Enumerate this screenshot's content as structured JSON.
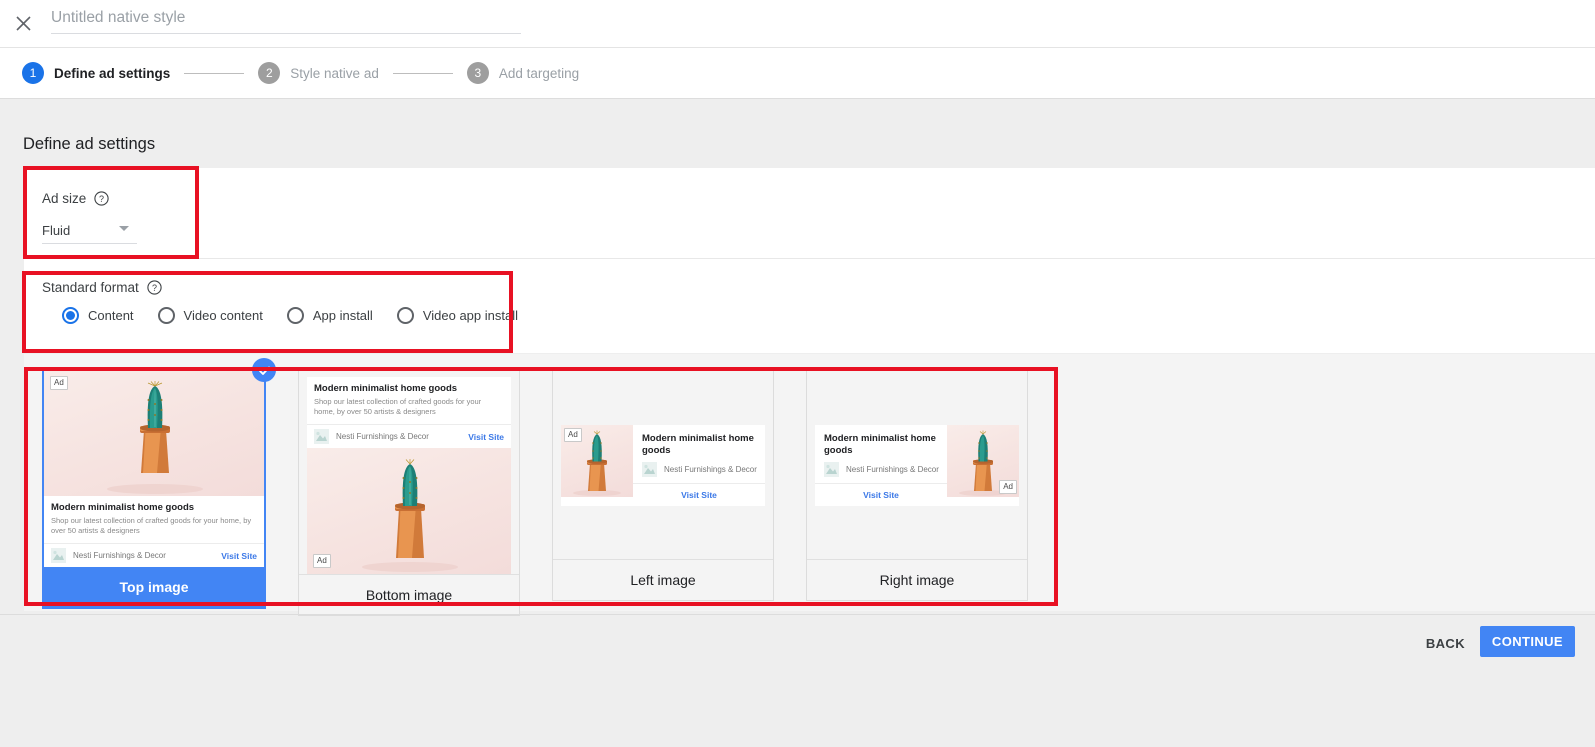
{
  "header": {
    "close_icon": "close-icon",
    "title_value": "",
    "title_placeholder": "Untitled native style"
  },
  "stepper": {
    "steps": [
      {
        "number": "1",
        "label": "Define ad settings",
        "state": "active"
      },
      {
        "number": "2",
        "label": "Style native ad",
        "state": "inactive"
      },
      {
        "number": "3",
        "label": "Add targeting",
        "state": "inactive"
      }
    ]
  },
  "page": {
    "heading": "Define ad settings"
  },
  "ad_size": {
    "label": "Ad size",
    "help_icon": "help-icon",
    "selected": "Fluid",
    "options": [
      "Fluid"
    ]
  },
  "standard_format": {
    "label": "Standard format",
    "help_icon": "help-icon",
    "options": [
      {
        "label": "Content",
        "checked": true
      },
      {
        "label": "Video content",
        "checked": false
      },
      {
        "label": "App install",
        "checked": false
      },
      {
        "label": "Video app install",
        "checked": false
      }
    ]
  },
  "ad_mock": {
    "ad_badge": "Ad",
    "headline": "Modern minimalist home goods",
    "body": "Shop our latest collection of crafted goods for your home, by over 50 artists & designers",
    "advertiser": "Nesti Furnishings & Decor",
    "cta": "Visit Site",
    "logo_icon": "image-placeholder-icon",
    "image_alt": "cactus-in-terracotta-pot-photo"
  },
  "layouts": {
    "cards": [
      {
        "id": "top-image",
        "label": "Top image",
        "selected": true,
        "check_icon": "check-circle-icon"
      },
      {
        "id": "bottom-image",
        "label": "Bottom image",
        "selected": false
      },
      {
        "id": "left-image",
        "label": "Left image",
        "selected": false
      },
      {
        "id": "right-image",
        "label": "Right image",
        "selected": false
      }
    ]
  },
  "footer": {
    "back_label": "BACK",
    "continue_label": "CONTINUE"
  },
  "colors": {
    "accent_blue": "#4285f4",
    "step_active": "#1a73e8",
    "step_inactive": "#9e9e9e",
    "annotation_red": "#e81123",
    "link_blue": "#3b78e7",
    "page_bg": "#eeeeee",
    "card_bg": "#f4f4f4"
  },
  "annotations": [
    {
      "name": "ad-size-highlight"
    },
    {
      "name": "standard-format-highlight"
    },
    {
      "name": "layout-cards-highlight"
    }
  ]
}
